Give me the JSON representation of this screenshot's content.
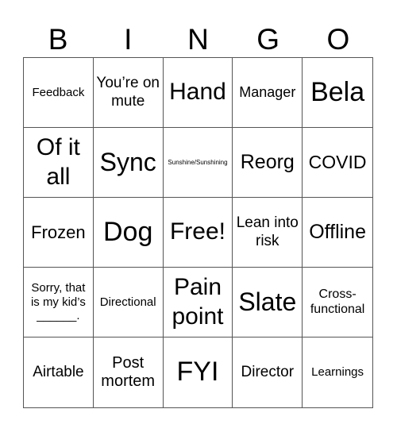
{
  "header": [
    "B",
    "I",
    "N",
    "G",
    "O"
  ],
  "board": {
    "cells": [
      "Feedback",
      "You’re on mute",
      "Hand",
      "Manager",
      "Bela",
      "Of it all",
      "Sync",
      "Sunshine/Sunshining",
      "Reorg",
      "COVID",
      "Frozen",
      "Dog",
      "Free!",
      "Lean into risk",
      "Offline",
      "Sorry, that is my kid’s ______.",
      "Directional",
      "Pain point",
      "Slate",
      "Cross-functional",
      "Airtable",
      "Post mortem",
      "FYI",
      "Director",
      "Learnings"
    ]
  }
}
